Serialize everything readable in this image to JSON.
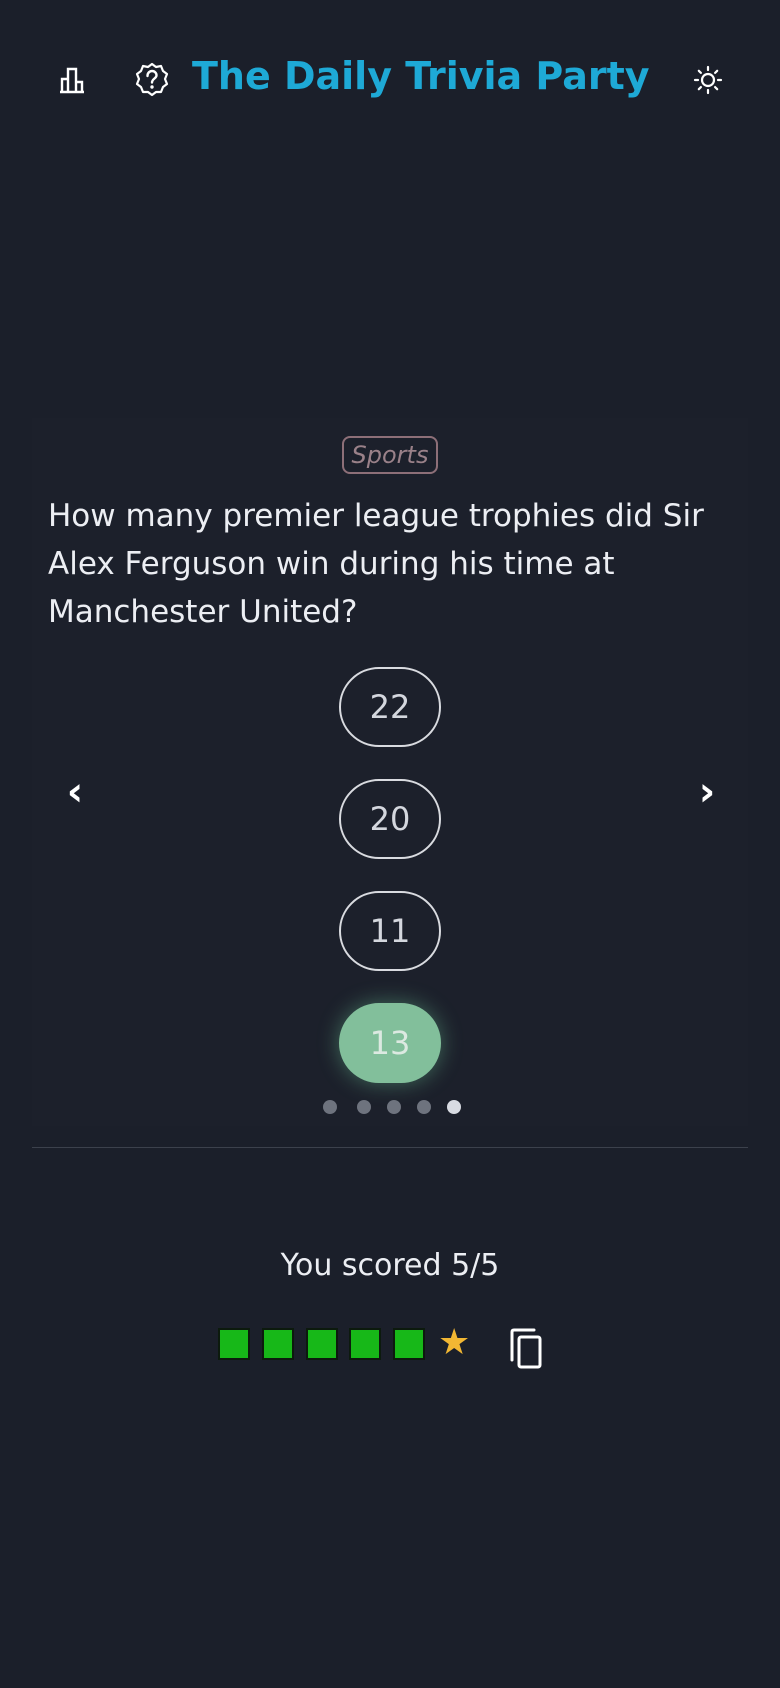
{
  "header": {
    "title": "The Daily Trivia Party",
    "title_color": "#1ea9d6",
    "icons": [
      "bar-chart-icon",
      "help-icon",
      "sun-icon"
    ]
  },
  "question_card": {
    "category": "Sports",
    "question": "How many premier league trophies did Sir Alex Ferguson win during his time at Manchester United?",
    "answers": [
      "22",
      "20",
      "11",
      "13"
    ],
    "selected_answer": "13",
    "prev_arrow": "‹",
    "next_arrow": "›",
    "page_count": 5,
    "current_page": 5
  },
  "results": {
    "score_text": "You scored 5/5",
    "correct_squares": 5,
    "square_color": "#17b818",
    "star": "★",
    "star_color": "#f2b733",
    "copy_icon": "copy-icon"
  }
}
